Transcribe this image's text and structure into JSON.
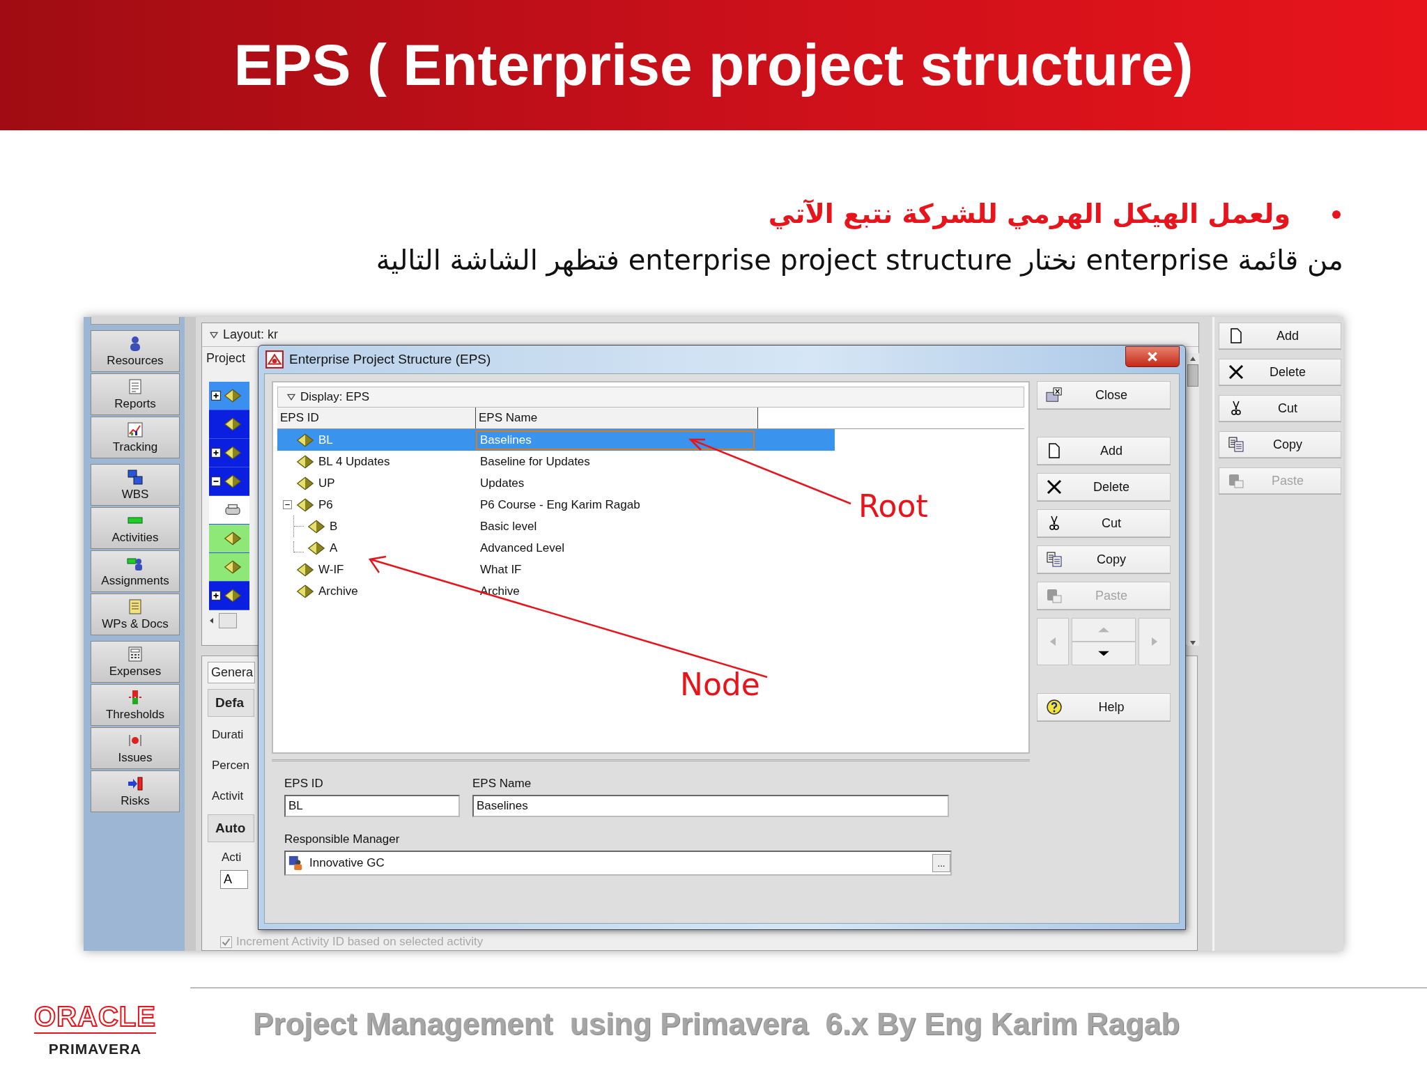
{
  "slide": {
    "title": "EPS ( Enterprise project structure)",
    "lines": [
      {
        "kind": "bullet",
        "text": "ولعمل الهيكل الهرمي للشركة نتبع الآتي"
      },
      {
        "kind": "plain",
        "text": "من قائمة  enterprise  نختار  enterprise project structure فتظهر الشاشة التالية"
      }
    ]
  },
  "app": {
    "sidebar": {
      "groups": [
        {
          "items": [
            {
              "kind": "person",
              "label": "Resources"
            },
            {
              "kind": "report",
              "label": "Reports"
            },
            {
              "kind": "chart",
              "label": "Tracking"
            }
          ]
        },
        {
          "items": [
            {
              "kind": "wbs",
              "label": "WBS"
            },
            {
              "kind": "bar",
              "label": "Activities"
            },
            {
              "kind": "assign",
              "label": "Assignments"
            },
            {
              "kind": "note",
              "label": "WPs & Docs"
            }
          ]
        },
        {
          "items": [
            {
              "kind": "calc",
              "label": "Expenses"
            },
            {
              "kind": "threshold",
              "label": "Thresholds"
            },
            {
              "kind": "issue",
              "label": "Issues"
            },
            {
              "kind": "risk",
              "label": "Risks"
            }
          ]
        }
      ]
    },
    "background": {
      "layout_label": "Layout: kr",
      "column": "Project",
      "tree": [
        {
          "kind": "node",
          "expanded": false,
          "selected": true
        },
        {
          "kind": "leaf",
          "selected": false
        },
        {
          "kind": "node",
          "expanded": false,
          "selected": false
        },
        {
          "kind": "node",
          "expanded": true,
          "selected": false
        },
        {
          "kind": "header",
          "selected": false
        },
        {
          "kind": "project",
          "selected": false
        },
        {
          "kind": "project",
          "selected": false
        },
        {
          "kind": "node",
          "expanded": false,
          "selected": false
        }
      ],
      "tab": "Genera",
      "section_1": "Defa",
      "labels": [
        "Durati",
        "Percen",
        "Activit"
      ],
      "section_2": "Auto",
      "field_label": "Acti",
      "field_value": "A",
      "checkbox": {
        "label": "Increment Activity ID based on selected activity",
        "checked": true,
        "disabled": true
      }
    },
    "toolbar": [
      {
        "kind": "add",
        "label": "Add",
        "disabled": false
      },
      {
        "kind": "delete",
        "label": "Delete",
        "disabled": false
      },
      {
        "kind": "cut",
        "label": "Cut",
        "disabled": false
      },
      {
        "kind": "copy",
        "label": "Copy",
        "disabled": false
      },
      {
        "kind": "paste",
        "label": "Paste",
        "disabled": true
      }
    ],
    "dialog": {
      "title": "Enterprise Project Structure (EPS)",
      "display": "Display: EPS",
      "columns": [
        "EPS ID",
        "EPS Name"
      ],
      "tree": [
        {
          "id": "BL",
          "name": "Baselines",
          "selected": true
        },
        {
          "id": "BL 4 Updates",
          "name": "Baseline for Updates",
          "selected": false
        },
        {
          "id": "UP",
          "name": "Updates",
          "selected": false
        },
        {
          "id": "P6",
          "name": "P6 Course - Eng Karim Ragab",
          "selected": false,
          "expanded": true,
          "children": [
            {
              "id": "B",
              "name": "Basic level",
              "selected": false
            },
            {
              "id": "A",
              "name": "Advanced Level",
              "selected": false
            }
          ]
        },
        {
          "id": "W-IF",
          "name": "What IF",
          "selected": false
        },
        {
          "id": "Archive",
          "name": "Archive",
          "selected": false
        }
      ],
      "close_button": {
        "label": "Close",
        "disabled": false
      },
      "buttons": [
        {
          "kind": "add",
          "label": "Add",
          "disabled": false
        },
        {
          "kind": "delete",
          "label": "Delete",
          "disabled": false
        },
        {
          "kind": "cut",
          "label": "Cut",
          "disabled": false
        },
        {
          "kind": "copy",
          "label": "Copy",
          "disabled": false
        },
        {
          "kind": "paste",
          "label": "Paste",
          "disabled": true
        }
      ],
      "nav": {
        "left_enabled": false,
        "up_enabled": false,
        "down_enabled": true,
        "right_enabled": false
      },
      "help_button": {
        "label": "Help",
        "disabled": false
      },
      "form": {
        "id_label": "EPS ID",
        "id_value": "BL",
        "name_label": "EPS Name",
        "name_value": "Baselines",
        "manager_label": "Responsible Manager",
        "manager_value": "Innovative GC",
        "browse": "..."
      }
    },
    "annotations": [
      {
        "kind": "root",
        "text": "Root"
      },
      {
        "kind": "node",
        "text": "Node"
      }
    ]
  },
  "footer": {
    "logo": "ORACLE",
    "logo_sub": "PRIMAVERA",
    "caption": "Project Management  using Primavera  6.x By Eng Karim Ragab"
  }
}
